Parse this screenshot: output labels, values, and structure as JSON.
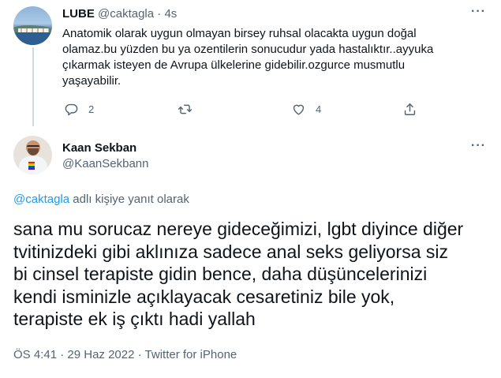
{
  "parent_tweet": {
    "display_name": "LUBE",
    "handle": "@caktagla",
    "separator": "·",
    "time": "4s",
    "text_lines": [
      "Anatomik olarak uygun olmayan birsey ruhsal olacakta uygun doğal",
      "olamaz.bu yüzden bu ya ozentilerin sonucudur yada hastalıktır..ayyuka",
      "çıkarmak isteyen de Avrupa ülkelerine gidebilir.ozgurce musmutlu",
      "yaşayabilir."
    ],
    "actions": {
      "reply_count": "2",
      "retweet_count": "",
      "like_count": "4"
    },
    "more_label": "···"
  },
  "main_tweet": {
    "display_name": "Kaan Sekban",
    "handle": "@KaanSekbann",
    "more_label": "···",
    "reply_mention": "@caktagla",
    "reply_suffix": " adlı kişiye yanıt olarak",
    "text_lines": [
      "sana mu sorucaz nereye gideceğimizi, lgbt diyince diğer",
      "tvitinizdeki gibi aklınıza sadece anal seks geliyorsa siz",
      "bi cinsel terapiste gidin bence, daha düşüncelerinizi",
      "kendi isminizle açıklayacak cesaretiniz bile yok,",
      "terapiste ek iş çıktı hadi yallah"
    ],
    "time": "ÖS 4:41",
    "date": "29 Haz 2022",
    "source": "Twitter for iPhone",
    "meta_separator": " · "
  },
  "icons": {
    "reply": "reply-icon",
    "retweet": "retweet-icon",
    "like": "heart-icon",
    "share": "share-icon",
    "more": "more-icon"
  },
  "colors": {
    "text": "#0f1419",
    "muted": "#536471",
    "accent": "#1d9bf0",
    "divider": "#cfd9de"
  }
}
